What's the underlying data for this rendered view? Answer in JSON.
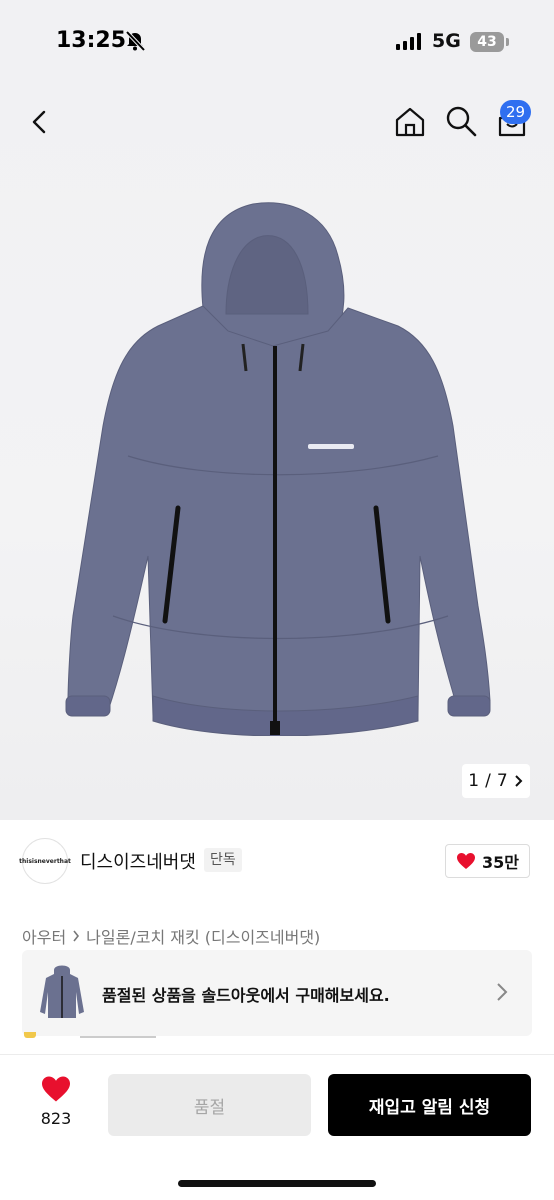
{
  "status_bar": {
    "time": "13:25",
    "network": "5G",
    "battery": "43"
  },
  "header": {
    "cart_count": "29"
  },
  "gallery": {
    "current": "1",
    "separator": "/",
    "total": "7",
    "index_fraction": "1/7"
  },
  "product": {
    "jacket_color": "#6b7190",
    "brand": {
      "logo_text": "thisisneverthat",
      "name": "디스이즈네버댓",
      "badge": "단독"
    },
    "likes": "35만"
  },
  "breadcrumb": {
    "category": "아우터",
    "subcategory": "나일론/코치 재킷 (디스이즈네버댓)"
  },
  "soldout_banner": {
    "message": "품절된 상품을 솔드아웃에서 구매해보세요."
  },
  "bottom_bar": {
    "wish_count": "823",
    "soldout_label": "품절",
    "restock_label": "재입고 알림 신청"
  },
  "colors": {
    "accent_blue": "#2f6ff0",
    "heart_red": "#e8102e",
    "black": "#000000"
  }
}
